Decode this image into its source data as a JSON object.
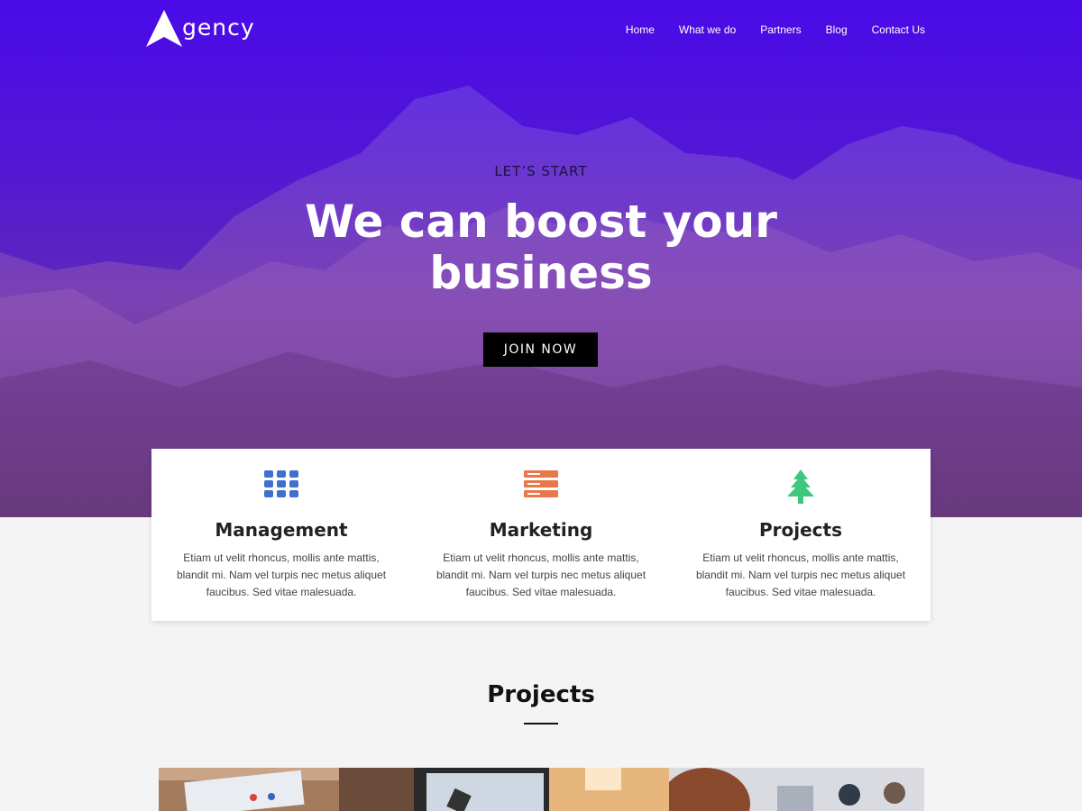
{
  "header": {
    "logo_text": "gency",
    "nav": [
      "Home",
      "What we do",
      "Partners",
      "Blog",
      "Contact Us"
    ]
  },
  "hero": {
    "eyebrow": "LET’S START",
    "title": "We can boost your business",
    "cta_label": "JOIN NOW"
  },
  "features": [
    {
      "icon": "grid-icon",
      "title": "Management",
      "text": "Etiam ut velit rhoncus, mollis ante mattis, blandit mi. Nam vel turpis nec metus aliquet faucibus. Sed vitae malesuada.",
      "color": "#3f6fd1"
    },
    {
      "icon": "server-icon",
      "title": "Marketing",
      "text": "Etiam ut velit rhoncus, mollis ante mattis, blandit mi. Nam vel turpis nec metus aliquet faucibus. Sed vitae malesuada.",
      "color": "#e8774a"
    },
    {
      "icon": "tree-icon",
      "title": "Projects",
      "text": "Etiam ut velit rhoncus, mollis ante mattis, blandit mi. Nam vel turpis nec metus aliquet faucibus. Sed vitae malesuada.",
      "color": "#3ec77f"
    }
  ],
  "projects_section": {
    "title": "Projects"
  },
  "colors": {
    "hero_top": "#4a0ae8",
    "hero_bottom": "#5a2a7e",
    "button_bg": "#000000"
  }
}
